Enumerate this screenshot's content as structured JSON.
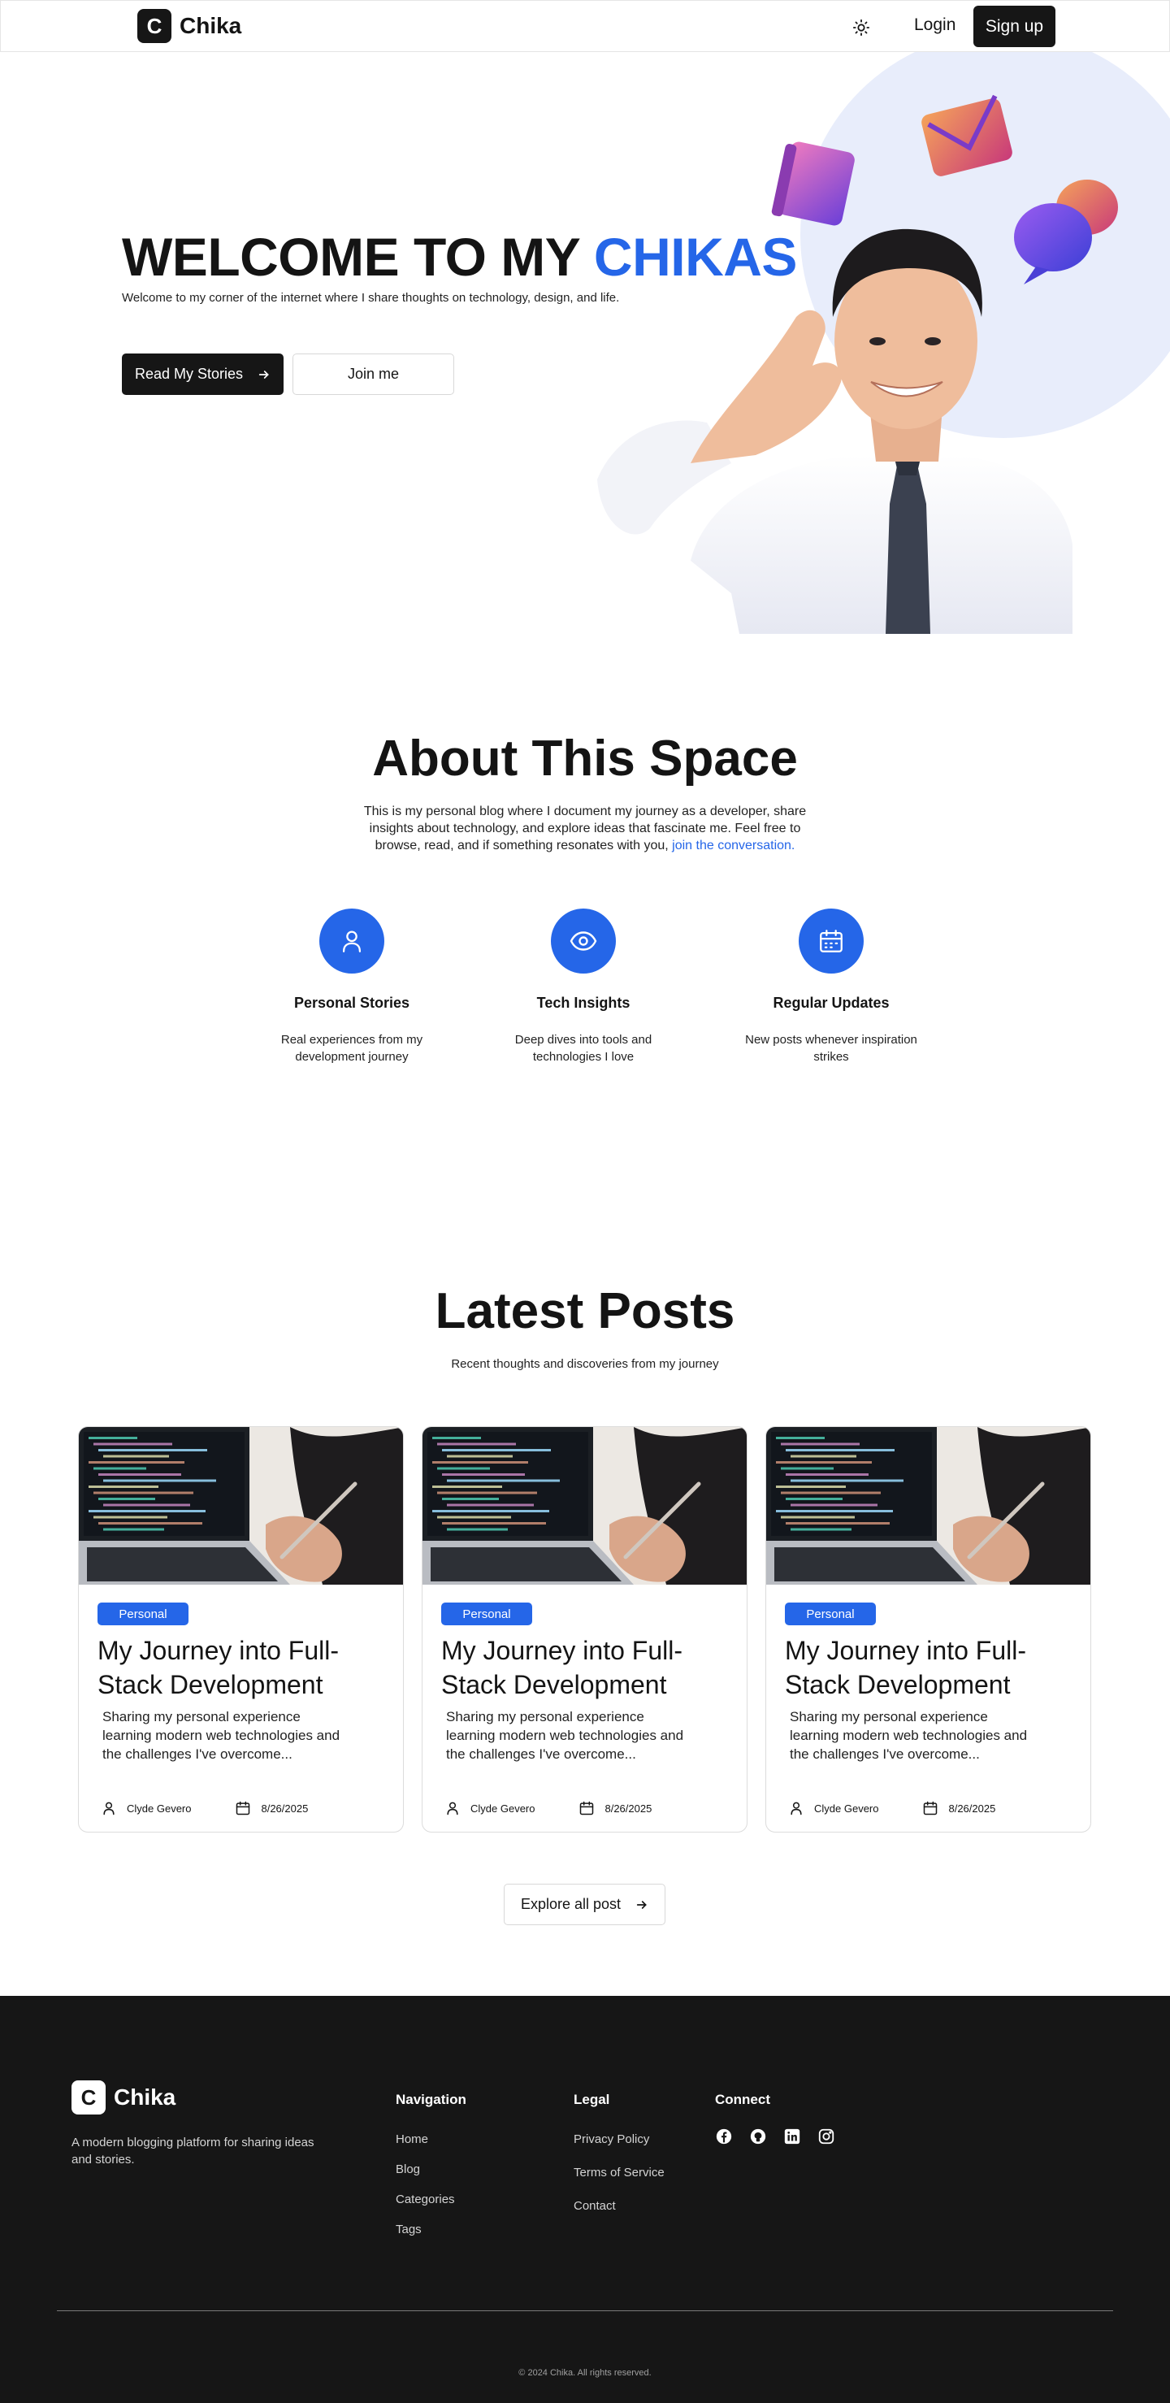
{
  "brand": {
    "logo_letter": "C",
    "name": "Chika"
  },
  "nav": {
    "login_label": "Login",
    "signup_label": "Sign up"
  },
  "hero": {
    "title_prefix": "WELCOME TO MY ",
    "title_accent": "CHIKAS",
    "subtitle": "Welcome to my corner of the internet where I share thoughts on technology, design, and life.",
    "primary_button": "Read My Stories",
    "secondary_button": "Join me"
  },
  "about": {
    "title": "About This Space",
    "text": "This is my personal blog where I document my journey as a developer, share insights about technology, and explore ideas that fascinate me. Feel free to browse, read, and if something resonates with you, ",
    "link_text": "join the conversation.",
    "features": [
      {
        "title": "Personal Stories",
        "description": "Real experiences from my development journey"
      },
      {
        "title": "Tech Insights",
        "description": "Deep dives into tools and technologies I love"
      },
      {
        "title": "Regular Updates",
        "description": "New posts whenever inspiration strikes"
      }
    ]
  },
  "posts": {
    "title": "Latest Posts",
    "subtitle": "Recent thoughts and discoveries from my journey",
    "items": [
      {
        "category": "Personal",
        "title": "My Journey into Full-Stack Development",
        "excerpt": "Sharing my personal experience learning modern web technologies and the challenges I've overcome...",
        "author": "Clyde Gevero",
        "date": "8/26/2025"
      },
      {
        "category": "Personal",
        "title": "My Journey into Full-Stack Development",
        "excerpt": "Sharing my personal experience learning modern web technologies and the challenges I've overcome...",
        "author": "Clyde Gevero",
        "date": "8/26/2025"
      },
      {
        "category": "Personal",
        "title": "My Journey into Full-Stack Development",
        "excerpt": "Sharing my personal experience learning modern web technologies and the challenges I've overcome...",
        "author": "Clyde Gevero",
        "date": "8/26/2025"
      }
    ],
    "explore_label": "Explore all post"
  },
  "footer": {
    "tagline": "A modern blogging platform for sharing ideas and stories.",
    "navigation": {
      "heading": "Navigation",
      "links": [
        "Home",
        "Blog",
        "Categories",
        "Tags"
      ]
    },
    "legal": {
      "heading": "Legal",
      "links": [
        "Privacy Policy",
        "Terms of Service",
        "Contact"
      ]
    },
    "connect": {
      "heading": "Connect",
      "icons": [
        "facebook-icon",
        "github-icon",
        "linkedin-icon",
        "instagram-icon"
      ]
    },
    "copyright": "© 2024 Chika. All rights reserved."
  },
  "colors": {
    "accent": "#2566e8",
    "dark": "#161616",
    "hero_circle": "#e8edfb"
  }
}
